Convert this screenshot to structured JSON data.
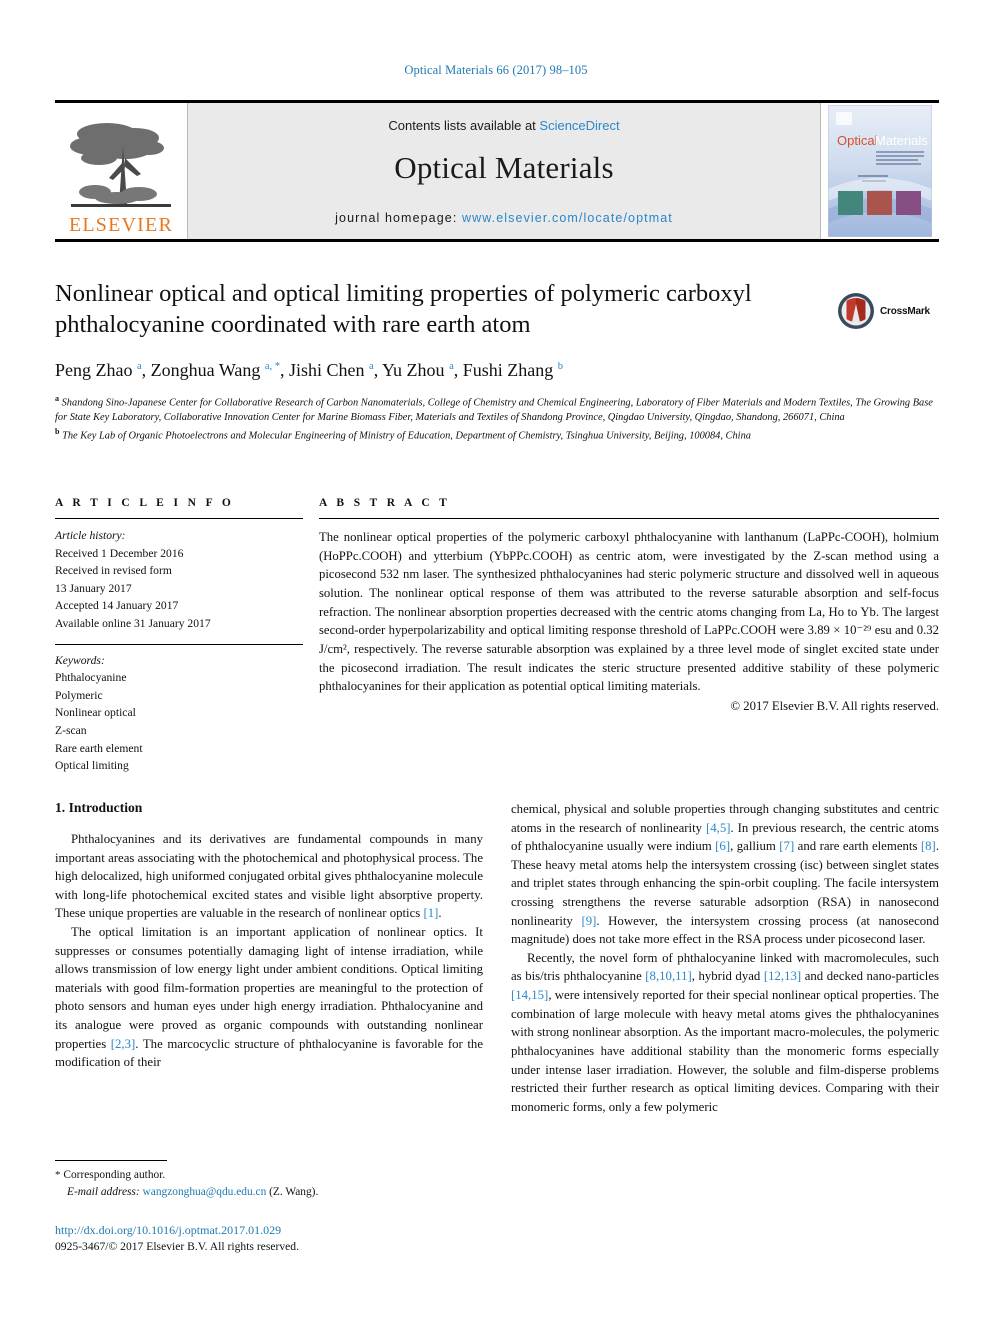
{
  "running_head": "Optical Materials 66 (2017) 98–105",
  "masthead": {
    "publisher_logo_text": "ELSEVIER",
    "contents_prefix": "Contents lists available at ",
    "contents_link": "ScienceDirect",
    "journal_title": "Optical Materials",
    "homepage_prefix": "journal homepage: ",
    "homepage_url": "www.elsevier.com/locate/optmat",
    "cover_title_left": "Optical",
    "cover_title_right": "Materials"
  },
  "crossmark": {
    "label": "CrossMark"
  },
  "article": {
    "title": "Nonlinear optical and optical limiting properties of polymeric carboxyl phthalocyanine coordinated with rare earth atom",
    "authors_html": "Peng Zhao <sup>a</sup>, Zonghua Wang <sup>a, *</sup>, Jishi Chen <sup>a</sup>, Yu Zhou <sup>a</sup>, Fushi Zhang <sup>b</sup>",
    "affiliation_a": "Shandong Sino-Japanese Center for Collaborative Research of Carbon Nanomaterials, College of Chemistry and Chemical Engineering, Laboratory of Fiber Materials and Modern Textiles, The Growing Base for State Key Laboratory, Collaborative Innovation Center for Marine Biomass Fiber, Materials and Textiles of Shandong Province, Qingdao University, Qingdao, Shandong, 266071, China",
    "affiliation_b": "The Key Lab of Organic Photoelectrons and Molecular Engineering of Ministry of Education, Department of Chemistry, Tsinghua University, Beijing, 100084, China",
    "affiliation_a_marker": "a",
    "affiliation_b_marker": "b"
  },
  "article_info": {
    "heading": "A R T I C L E   I N F O",
    "history_label": "Article history:",
    "history_lines": [
      "Received 1 December 2016",
      "Received in revised form",
      "13 January 2017",
      "Accepted 14 January 2017",
      "Available online 31 January 2017"
    ],
    "keywords_label": "Keywords:",
    "keywords": [
      "Phthalocyanine",
      "Polymeric",
      "Nonlinear optical",
      "Z-scan",
      "Rare earth element",
      "Optical limiting"
    ]
  },
  "abstract": {
    "heading": "A B S T R A C T",
    "text": "The nonlinear optical properties of the polymeric carboxyl phthalocyanine with lanthanum (LaPPc-COOH), holmium (HoPPc.COOH) and ytterbium (YbPPc.COOH) as centric atom, were investigated by the Z-scan method using a picosecond 532 nm laser. The synthesized phthalocyanines had steric polymeric structure and dissolved well in aqueous solution. The nonlinear optical response of them was attributed to the reverse saturable absorption and self-focus refraction. The nonlinear absorption properties decreased with the centric atoms changing from La, Ho to Yb. The largest second-order hyperpolarizability and optical limiting response threshold of LaPPc.COOH were 3.89 × 10⁻²⁹ esu and 0.32 J/cm², respectively. The reverse saturable absorption was explained by a three level mode of singlet excited state under the picosecond irradiation. The result indicates the steric structure presented additive stability of these polymeric phthalocyanines for their application as potential optical limiting materials.",
    "copyright": "© 2017 Elsevier B.V. All rights reserved."
  },
  "introduction": {
    "heading": "1. Introduction",
    "left_paragraphs": [
      "Phthalocyanines and its derivatives are fundamental compounds in many important areas associating with the photochemical and photophysical process. The high delocalized, high uniformed conjugated orbital gives phthalocyanine molecule with long-life photochemical excited states and visible light absorptive property. These unique properties are valuable in the research of nonlinear optics [1].",
      "The optical limitation is an important application of nonlinear optics. It suppresses or consumes potentially damaging light of intense irradiation, while allows transmission of low energy light under ambient conditions. Optical limiting materials with good film-formation properties are meaningful to the protection of photo sensors and human eyes under high energy irradiation. Phthalocyanine and its analogue were proved as organic compounds with outstanding nonlinear properties [2,3]. The marcocyclic structure of phthalocyanine is favorable for the modification of their"
    ],
    "right_paragraphs": [
      "chemical, physical and soluble properties through changing substitutes and centric atoms in the research of nonlinearity [4,5]. In previous research, the centric atoms of phthalocyanine usually were indium [6], gallium [7] and rare earth elements [8]. These heavy metal atoms help the intersystem crossing (isc) between singlet states and triplet states through enhancing the spin-orbit coupling. The facile intersystem crossing strengthens the reverse saturable adsorption (RSA) in nanosecond nonlinearity [9]. However, the intersystem crossing process (at nanosecond magnitude) does not take more effect in the RSA process under picosecond laser.",
      "Recently, the novel form of phthalocyanine linked with macromolecules, such as bis/tris phthalocyanine [8,10,11], hybrid dyad [12,13] and decked nano-particles [14,15], were intensively reported for their special nonlinear optical properties. The combination of large molecule with heavy metal atoms gives the phthalocyanines with strong nonlinear absorption. As the important macro-molecules, the polymeric phthalocyanines have additional stability than the monomeric forms especially under intense laser irradiation. However, the soluble and film-disperse problems restricted their further research as optical limiting devices. Comparing with their monomeric forms, only a few polymeric"
    ]
  },
  "footer": {
    "corresponding_marker": "*",
    "corresponding_text": "Corresponding author.",
    "email_label": "E-mail address:",
    "email": "wangzonghua@qdu.edu.cn",
    "email_suffix": "(Z. Wang).",
    "doi": "http://dx.doi.org/10.1016/j.optmat.2017.01.029",
    "issn_line": "0925-3467/© 2017 Elsevier B.V. All rights reserved."
  },
  "colors": {
    "link": "#2a87c8",
    "running_head": "#1f7ab0",
    "elsevier_orange": "#E87722",
    "masthead_gray": "#eaeaea"
  }
}
